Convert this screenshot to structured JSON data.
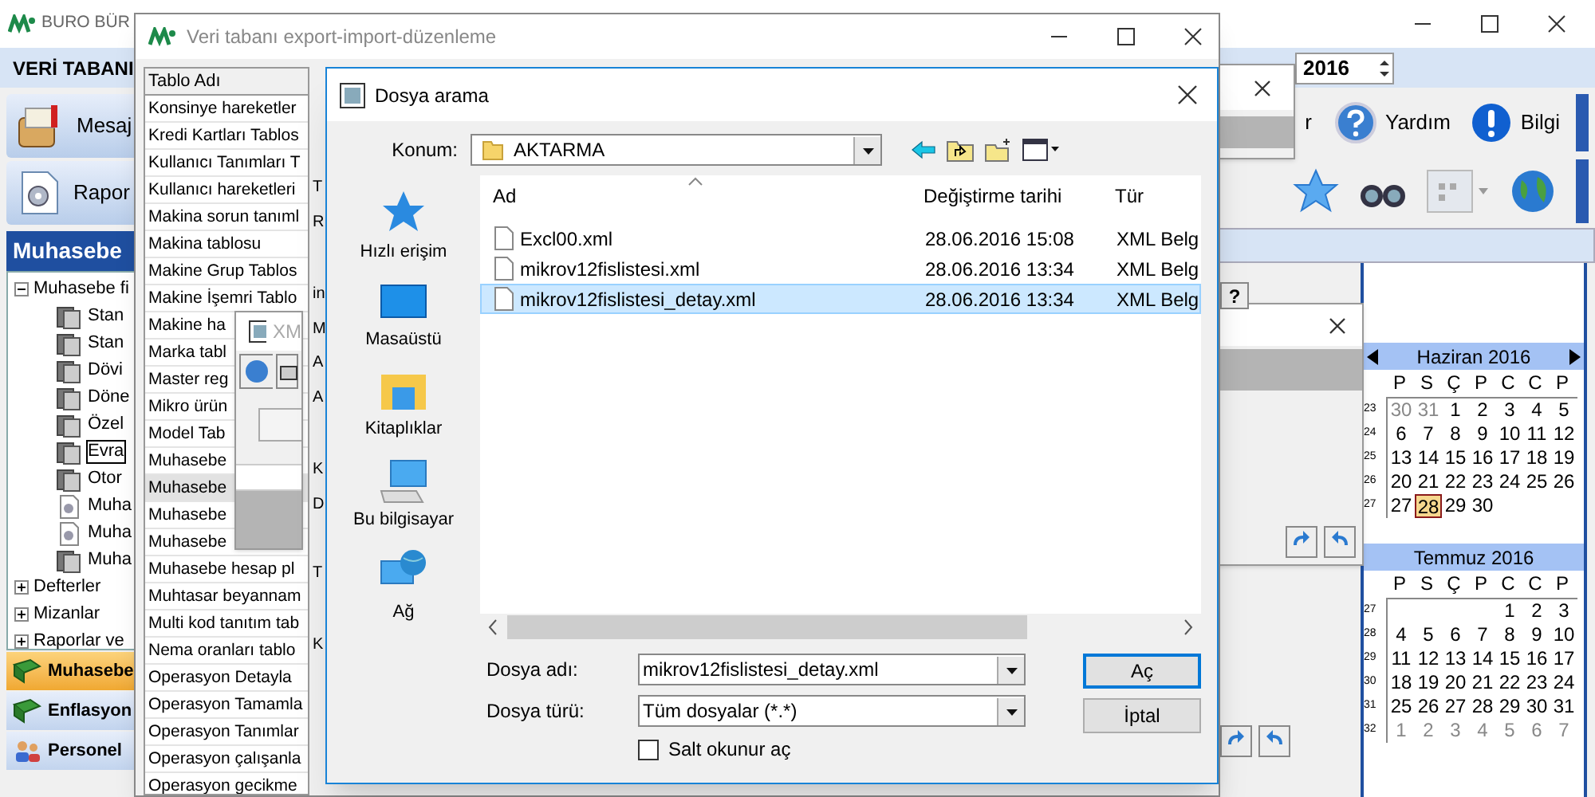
{
  "main_window": {
    "title": "BURO BÜR",
    "menu": "VERİ TABANI",
    "year": "2016",
    "help_button": "?",
    "toolbar": [
      {
        "label": "Mesaj",
        "kind": "mail"
      },
      {
        "label": "Rapor",
        "kind": "report"
      }
    ],
    "cut_label": "r",
    "right_toolbar": [
      {
        "label": "Yardım",
        "kind": "help"
      },
      {
        "label": "Bilgi",
        "kind": "info"
      }
    ]
  },
  "sidebar": {
    "header": "Muhasebe",
    "tree": [
      {
        "label": "Muhasebe fi",
        "expanded": true,
        "children": [
          {
            "label": "Stan",
            "kind": "table",
            "selected": false
          },
          {
            "label": "Stan",
            "kind": "table",
            "selected": false
          },
          {
            "label": "Dövi",
            "kind": "table",
            "selected": false
          },
          {
            "label": "Döne",
            "kind": "table",
            "selected": false
          },
          {
            "label": "Özel",
            "kind": "table",
            "selected": false
          },
          {
            "label": "Evra",
            "kind": "table",
            "selected": true
          },
          {
            "label": "Otor",
            "kind": "table",
            "selected": false
          },
          {
            "label": "Muha",
            "kind": "report",
            "selected": false
          },
          {
            "label": "Muha",
            "kind": "report",
            "selected": false
          },
          {
            "label": "Muha",
            "kind": "table",
            "selected": false
          }
        ]
      },
      {
        "label": "Defterler",
        "expanded": false
      },
      {
        "label": "Mizanlar",
        "expanded": false
      },
      {
        "label": "Raporlar ve",
        "expanded": false
      }
    ],
    "nav": [
      {
        "label": "Muhasebe",
        "selected": true,
        "kind": "book"
      },
      {
        "label": "Enflasyon",
        "selected": false,
        "kind": "book"
      },
      {
        "label": "Personel",
        "selected": false,
        "kind": "people"
      }
    ]
  },
  "calendars": [
    {
      "title": "Haziran 2016",
      "arrows": true,
      "weekdays": [
        "P",
        "S",
        "Ç",
        "P",
        "C",
        "C",
        "P"
      ],
      "weeks": [
        {
          "number": "23",
          "days": [
            {
              "day": "30",
              "muted": true,
              "selected": false
            },
            {
              "day": "31",
              "muted": true,
              "selected": false
            },
            {
              "day": "1",
              "muted": false,
              "selected": false
            },
            {
              "day": "2",
              "muted": false,
              "selected": false
            },
            {
              "day": "3",
              "muted": false,
              "selected": false
            },
            {
              "day": "4",
              "muted": false,
              "selected": false
            },
            {
              "day": "5",
              "muted": false,
              "selected": false
            }
          ]
        },
        {
          "number": "24",
          "days": [
            {
              "day": "6",
              "muted": false,
              "selected": false
            },
            {
              "day": "7",
              "muted": false,
              "selected": false
            },
            {
              "day": "8",
              "muted": false,
              "selected": false
            },
            {
              "day": "9",
              "muted": false,
              "selected": false
            },
            {
              "day": "10",
              "muted": false,
              "selected": false
            },
            {
              "day": "11",
              "muted": false,
              "selected": false
            },
            {
              "day": "12",
              "muted": false,
              "selected": false
            }
          ]
        },
        {
          "number": "25",
          "days": [
            {
              "day": "13",
              "muted": false,
              "selected": false
            },
            {
              "day": "14",
              "muted": false,
              "selected": false
            },
            {
              "day": "15",
              "muted": false,
              "selected": false
            },
            {
              "day": "16",
              "muted": false,
              "selected": false
            },
            {
              "day": "17",
              "muted": false,
              "selected": false
            },
            {
              "day": "18",
              "muted": false,
              "selected": false
            },
            {
              "day": "19",
              "muted": false,
              "selected": false
            }
          ]
        },
        {
          "number": "26",
          "days": [
            {
              "day": "20",
              "muted": false,
              "selected": false
            },
            {
              "day": "21",
              "muted": false,
              "selected": false
            },
            {
              "day": "22",
              "muted": false,
              "selected": false
            },
            {
              "day": "23",
              "muted": false,
              "selected": false
            },
            {
              "day": "24",
              "muted": false,
              "selected": false
            },
            {
              "day": "25",
              "muted": false,
              "selected": false
            },
            {
              "day": "26",
              "muted": false,
              "selected": false
            }
          ]
        },
        {
          "number": "27",
          "days": [
            {
              "day": "27",
              "muted": false,
              "selected": false
            },
            {
              "day": "28",
              "muted": false,
              "selected": true
            },
            {
              "day": "29",
              "muted": false,
              "selected": false
            },
            {
              "day": "30",
              "muted": false,
              "selected": false
            }
          ]
        }
      ]
    },
    {
      "title": "Temmuz 2016",
      "arrows": false,
      "weekdays": [
        "P",
        "S",
        "Ç",
        "P",
        "C",
        "C",
        "P"
      ],
      "weeks": [
        {
          "number": "27",
          "days": [
            {
              "day": "1",
              "muted": false,
              "selected": false
            },
            {
              "day": "2",
              "muted": false,
              "selected": false
            },
            {
              "day": "3",
              "muted": false,
              "selected": false
            }
          ]
        },
        {
          "number": "28",
          "days": [
            {
              "day": "4",
              "muted": false,
              "selected": false
            },
            {
              "day": "5",
              "muted": false,
              "selected": false
            },
            {
              "day": "6",
              "muted": false,
              "selected": false
            },
            {
              "day": "7",
              "muted": false,
              "selected": false
            },
            {
              "day": "8",
              "muted": false,
              "selected": false
            },
            {
              "day": "9",
              "muted": false,
              "selected": false
            },
            {
              "day": "10",
              "muted": false,
              "selected": false
            }
          ]
        },
        {
          "number": "29",
          "days": [
            {
              "day": "11",
              "muted": false,
              "selected": false
            },
            {
              "day": "12",
              "muted": false,
              "selected": false
            },
            {
              "day": "13",
              "muted": false,
              "selected": false
            },
            {
              "day": "14",
              "muted": false,
              "selected": false
            },
            {
              "day": "15",
              "muted": false,
              "selected": false
            },
            {
              "day": "16",
              "muted": false,
              "selected": false
            },
            {
              "day": "17",
              "muted": false,
              "selected": false
            }
          ]
        },
        {
          "number": "30",
          "days": [
            {
              "day": "18",
              "muted": false,
              "selected": false
            },
            {
              "day": "19",
              "muted": false,
              "selected": false
            },
            {
              "day": "20",
              "muted": false,
              "selected": false
            },
            {
              "day": "21",
              "muted": false,
              "selected": false
            },
            {
              "day": "22",
              "muted": false,
              "selected": false
            },
            {
              "day": "23",
              "muted": false,
              "selected": false
            },
            {
              "day": "24",
              "muted": false,
              "selected": false
            }
          ]
        },
        {
          "number": "31",
          "days": [
            {
              "day": "25",
              "muted": false,
              "selected": false
            },
            {
              "day": "26",
              "muted": false,
              "selected": false
            },
            {
              "day": "27",
              "muted": false,
              "selected": false
            },
            {
              "day": "28",
              "muted": false,
              "selected": false
            },
            {
              "day": "29",
              "muted": false,
              "selected": false
            },
            {
              "day": "30",
              "muted": false,
              "selected": false
            },
            {
              "day": "31",
              "muted": false,
              "selected": false
            }
          ]
        },
        {
          "number": "32",
          "days": [
            {
              "day": "1",
              "muted": true,
              "selected": false
            },
            {
              "day": "2",
              "muted": true,
              "selected": false
            },
            {
              "day": "3",
              "muted": true,
              "selected": false
            },
            {
              "day": "4",
              "muted": true,
              "selected": false
            },
            {
              "day": "5",
              "muted": true,
              "selected": false
            },
            {
              "day": "6",
              "muted": true,
              "selected": false
            },
            {
              "day": "7",
              "muted": true,
              "selected": false
            }
          ]
        }
      ]
    }
  ],
  "export_window": {
    "title": "Veri tabanı export-import-düzenleme",
    "column": "Tablo Adı",
    "rows": [
      {
        "name": "Konsinye hareketler",
        "selected": false
      },
      {
        "name": "Kredi Kartları Tablos",
        "selected": false
      },
      {
        "name": "Kullanıcı Tanımları T",
        "selected": false
      },
      {
        "name": "Kullanıcı hareketleri",
        "selected": false
      },
      {
        "name": "Makina sorun tanıml",
        "selected": false
      },
      {
        "name": "Makina tablosu",
        "selected": false
      },
      {
        "name": "Makine Grup Tablos",
        "selected": false
      },
      {
        "name": "Makine İşemri Tablo",
        "selected": false
      },
      {
        "name": "Makine ha",
        "selected": false
      },
      {
        "name": "Marka tabl",
        "selected": false
      },
      {
        "name": "Master reg",
        "selected": false
      },
      {
        "name": "Mikro ürün",
        "selected": false
      },
      {
        "name": "Model Tab",
        "selected": false
      },
      {
        "name": "Muhasebe",
        "selected": false
      },
      {
        "name": "Muhasebe",
        "selected": true
      },
      {
        "name": "Muhasebe",
        "selected": false
      },
      {
        "name": "Muhasebe",
        "selected": false
      },
      {
        "name": "Muhasebe hesap pl",
        "selected": false
      },
      {
        "name": "Muhtasar beyannam",
        "selected": false
      },
      {
        "name": "Multi kod tanıtım tab",
        "selected": false
      },
      {
        "name": "Nema oranları tablo",
        "selected": false
      },
      {
        "name": "Operasyon Detayla",
        "selected": false
      },
      {
        "name": "Operasyon Tamamla",
        "selected": false
      },
      {
        "name": "Operasyon Tanımlar",
        "selected": false
      },
      {
        "name": "Operasyon çalışanla",
        "selected": false
      },
      {
        "name": "Operasyon gecikme",
        "selected": false
      }
    ],
    "side_labels": [
      "T",
      "R",
      "in",
      "M",
      "A",
      "A",
      "K",
      "D",
      "T",
      "K"
    ],
    "small_dialog_title": "XM"
  },
  "file_dialog": {
    "title": "Dosya arama",
    "location_label": "Konum:",
    "location": "AKTARMA",
    "places": [
      {
        "label": "Hızlı erişim",
        "kind": "star"
      },
      {
        "label": "Masaüstü",
        "kind": "desktop"
      },
      {
        "label": "Kitaplıklar",
        "kind": "library"
      },
      {
        "label": "Bu bilgisayar",
        "kind": "computer"
      },
      {
        "label": "Ağ",
        "kind": "network"
      }
    ],
    "columns": [
      "Ad",
      "Değiştirme tarihi",
      "Tür"
    ],
    "files": [
      {
        "name": "Excl00.xml",
        "date": "28.06.2016 15:08",
        "type": "XML Belg",
        "selected": false
      },
      {
        "name": "mikrov12fislistesi.xml",
        "date": "28.06.2016 13:34",
        "type": "XML Belg",
        "selected": false
      },
      {
        "name": "mikrov12fislistesi_detay.xml",
        "date": "28.06.2016 13:34",
        "type": "XML Belg",
        "selected": true
      }
    ],
    "filename_label": "Dosya adı:",
    "filename": "mikrov12fislistesi_detay.xml",
    "filetype_label": "Dosya türü:",
    "filetype": "Tüm dosyalar (*.*)",
    "readonly": {
      "label": "Salt okunur aç",
      "checked": false
    },
    "buttons": [
      "Aç",
      "İptal"
    ]
  }
}
